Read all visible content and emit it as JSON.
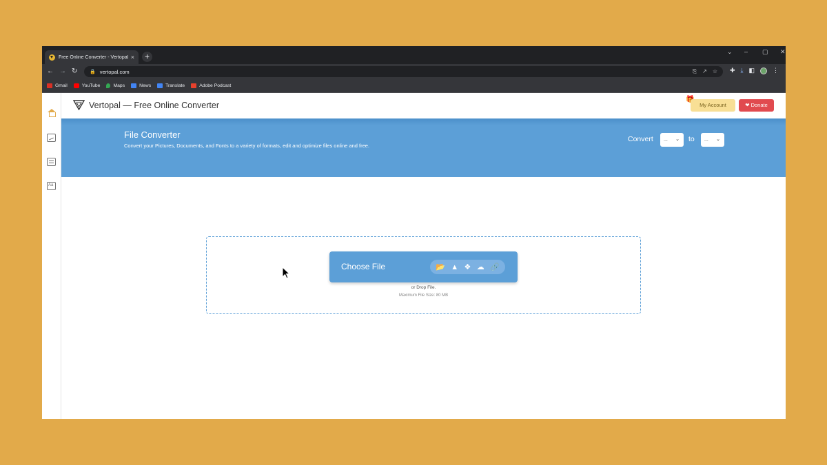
{
  "browser": {
    "tab_title": "Free Online Converter - Vertopal",
    "tab_close": "×",
    "new_tab": "+",
    "url": "vertopal.com",
    "window_controls": [
      "⌄",
      "–",
      "▢",
      "✕"
    ],
    "nav": {
      "back": "←",
      "forward": "→",
      "reload": "↻"
    },
    "bookmarks": [
      {
        "label": "Gmail",
        "color": "#d93025"
      },
      {
        "label": "YouTube",
        "color": "#ff0000"
      },
      {
        "label": "Maps",
        "color": "#34a853"
      },
      {
        "label": "News",
        "color": "#4285f4"
      },
      {
        "label": "Translate",
        "color": "#4285f4"
      },
      {
        "label": "Adobe Podcast",
        "color": "#e8412c"
      }
    ]
  },
  "sidebar": {
    "items": [
      {
        "icon": "home-icon",
        "active": true
      },
      {
        "icon": "image-icon"
      },
      {
        "icon": "document-icon"
      },
      {
        "icon": "font-icon",
        "text": "Aa"
      }
    ]
  },
  "header": {
    "brand": "Vertopal — Free Online Converter",
    "account_label": "My Account",
    "donate_label": "Donate"
  },
  "hero": {
    "title": "File Converter",
    "subtitle": "Convert your Pictures, Documents, and Fonts to a variety of formats, edit and optimize files online and free.",
    "convert_label": "Convert",
    "to_label": "to",
    "from_value": "...",
    "to_value": "..."
  },
  "upload": {
    "choose_label": "Choose File",
    "sources": [
      "folder-icon",
      "google-drive-icon",
      "dropbox-icon",
      "onedrive-icon",
      "link-icon"
    ],
    "drop_text": "or Drop File.",
    "limit_text": "Maximum File Size: 80 MB"
  },
  "colors": {
    "background": "#e2aa4a",
    "primary": "#5c9fd7",
    "donate": "#e14a4f",
    "account": "#f8df95"
  }
}
